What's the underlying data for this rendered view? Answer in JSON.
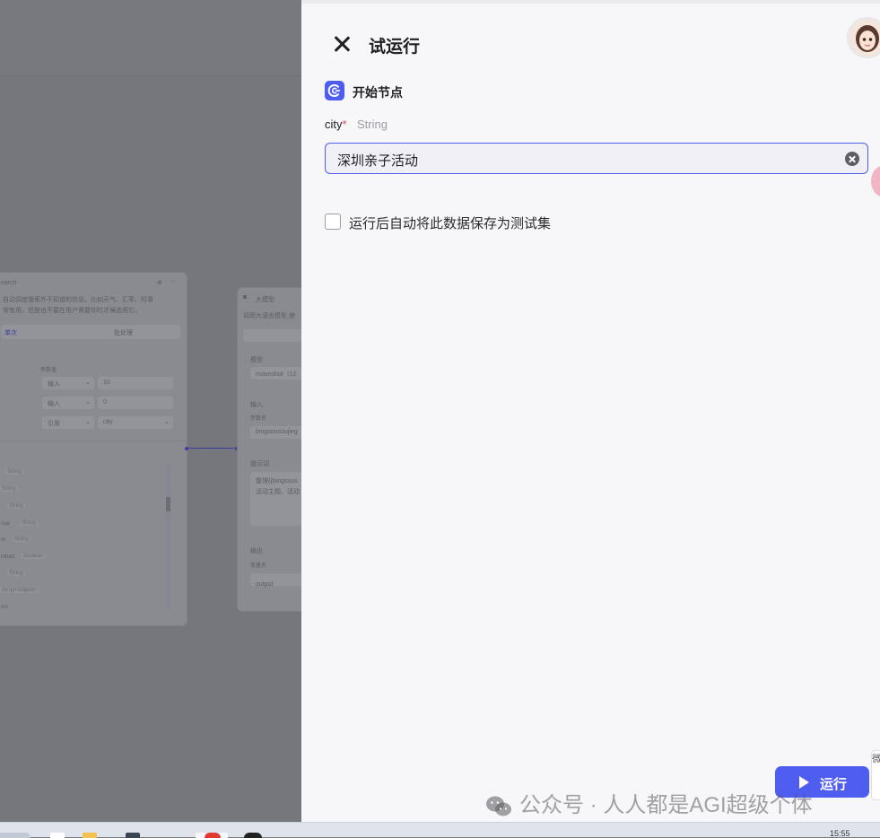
{
  "canvas": {
    "search_node": {
      "title": "earch",
      "desc_line1": "自动调度搜索外不知道的信息。比如天气、汇率、时事",
      "desc_line2": "常有用。但是也不要在用户需要你时才候选用它。",
      "tab_left": "单次",
      "tab_right": "批处理",
      "param_header": "参数值",
      "rows": [
        {
          "mode": "输入",
          "value": "10"
        },
        {
          "mode": "输入",
          "value": "0"
        },
        {
          "mode": "引用",
          "value": "city"
        }
      ],
      "outputs": [
        {
          "name": "",
          "type": "String"
        },
        {
          "name": "",
          "type": "String"
        },
        {
          "name": "",
          "type": "String"
        },
        {
          "name": "mat",
          "type": "String"
        },
        {
          "name": "nt",
          "type": "String"
        },
        {
          "name": "mbed",
          "type": "Boolean"
        },
        {
          "name": "",
          "type": "String"
        },
        {
          "name": "",
          "type": "Array<Object>"
        },
        {
          "name": "ms",
          "type": ""
        }
      ]
    },
    "llm_node": {
      "title": "大模型",
      "desc": "调用大语言模型,使",
      "model_label": "模型",
      "model_value": "moonshot（12",
      "input_label": "输入",
      "param_label": "参数名",
      "param_value": "bingsousoujieg",
      "prompt_label": "提示词",
      "prompt_text1": "整理{{bingsous",
      "prompt_text2": "活动主题、活动",
      "output_label": "输出",
      "var_label": "变量名",
      "output_value": "output"
    }
  },
  "panel": {
    "title": "试运行",
    "node_title": "开始节点",
    "field_label": "city",
    "required_mark": "*",
    "field_type": "String",
    "input_value": "深圳亲子活动",
    "checkbox_label": "运行后自动将此数据保存为测试集",
    "run_label": "运行"
  },
  "side_tab_text": "微",
  "watermark": "公众号 · 人人都是AGI超级个体",
  "clock": "15:55",
  "colors": {
    "accent": "#4f5cf0",
    "required": "#e5484d"
  }
}
